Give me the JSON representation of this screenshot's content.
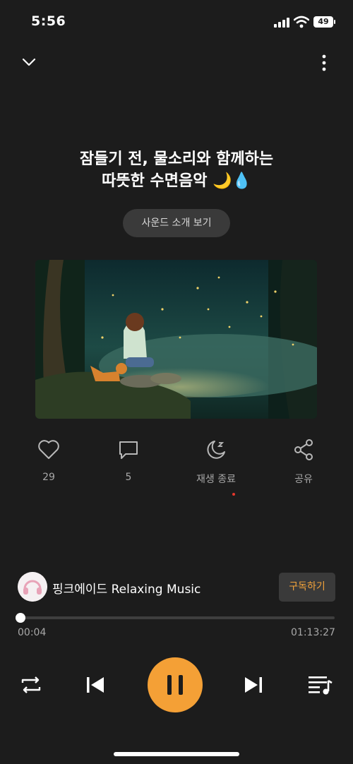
{
  "status_bar": {
    "time": "5:56",
    "battery": "49"
  },
  "header": {
    "collapse_icon": "chevron-down-icon",
    "menu_icon": "more-vertical-icon"
  },
  "track": {
    "title_line1": "잠들기 전, 물소리와 함께하는",
    "title_line2": "따뜻한 수면음악",
    "title_emoji": "🌙💧",
    "intro_button": "사운드 소개 보기"
  },
  "actions": {
    "like": {
      "icon": "heart-icon",
      "label": "29"
    },
    "comment": {
      "icon": "comment-icon",
      "label": "5"
    },
    "sleep": {
      "icon": "sleep-timer-icon",
      "label": "재생 종료"
    },
    "share": {
      "icon": "share-icon",
      "label": "공유"
    }
  },
  "channel": {
    "name": "핑크에이드 Relaxing Music",
    "subscribe_label": "구독하기"
  },
  "progress": {
    "current": "00:04",
    "total": "01:13:27",
    "fraction": 0.001
  },
  "controls": {
    "repeat": "repeat-icon",
    "previous": "skip-previous-icon",
    "play_pause": "pause-icon",
    "next": "skip-next-icon",
    "playlist": "playlist-icon"
  },
  "colors": {
    "accent": "#f4a036",
    "subscribe_text": "#f3a33a",
    "background": "#1c1c1c"
  }
}
